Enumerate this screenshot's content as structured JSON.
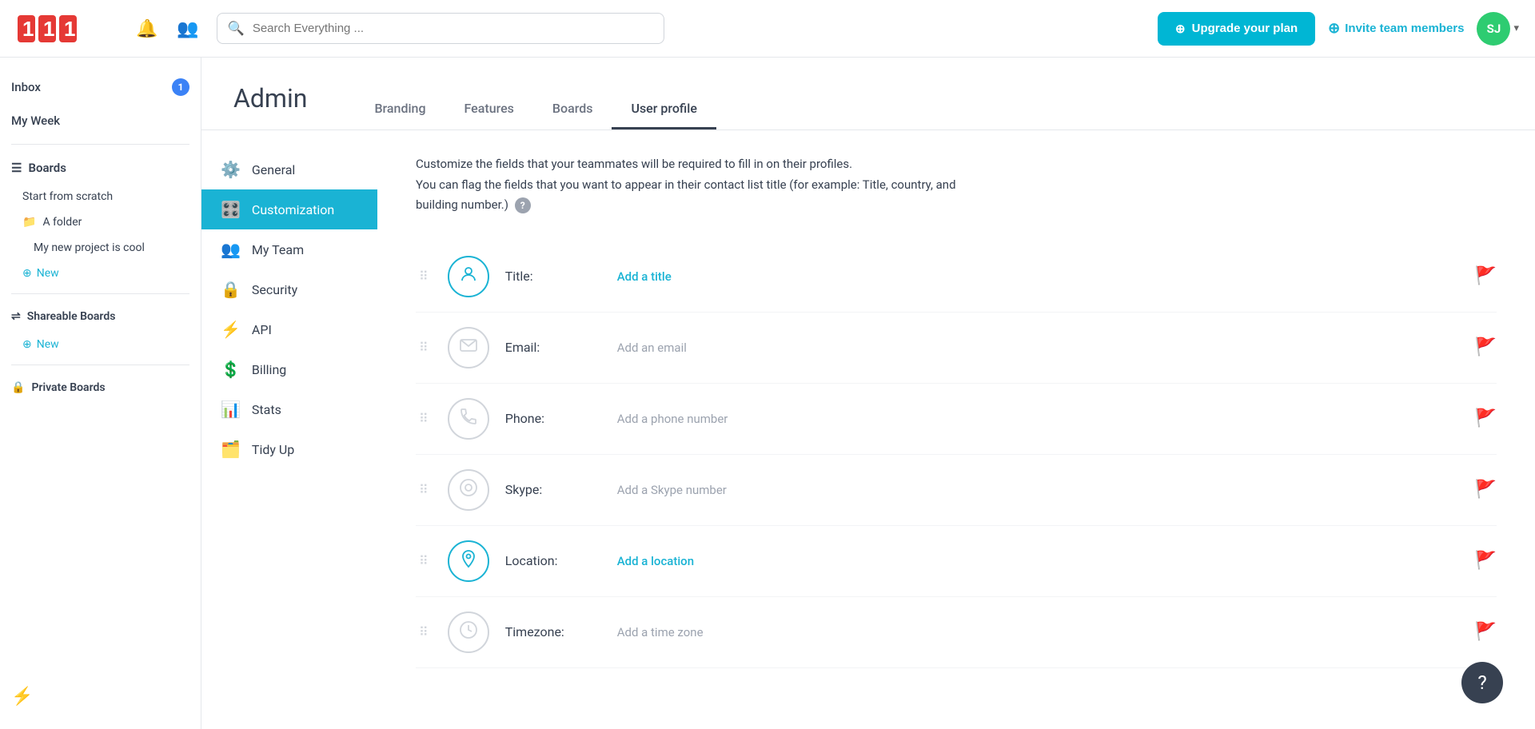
{
  "header": {
    "search_placeholder": "Search Everything ...",
    "upgrade_label": "Upgrade your plan",
    "invite_label": "Invite team members",
    "avatar_initials": "SJ"
  },
  "sidebar": {
    "inbox_label": "Inbox",
    "inbox_badge": "1",
    "my_week_label": "My Week",
    "boards_label": "Boards",
    "start_scratch_label": "Start from scratch",
    "folder_label": "A folder",
    "project_label": "My new project is cool",
    "new_label": "New",
    "shareable_label": "Shareable Boards",
    "new2_label": "New",
    "private_label": "Private Boards"
  },
  "admin": {
    "title": "Admin",
    "tabs": [
      {
        "id": "branding",
        "label": "Branding"
      },
      {
        "id": "features",
        "label": "Features"
      },
      {
        "id": "boards",
        "label": "Boards"
      },
      {
        "id": "user-profile",
        "label": "User profile"
      }
    ],
    "active_tab": "user-profile",
    "menu": [
      {
        "id": "general",
        "label": "General",
        "icon": "⚙️"
      },
      {
        "id": "customization",
        "label": "Customization",
        "icon": "🎛️",
        "active": true
      },
      {
        "id": "my-team",
        "label": "My Team",
        "icon": "👥"
      },
      {
        "id": "security",
        "label": "Security",
        "icon": "🔒"
      },
      {
        "id": "api",
        "label": "API",
        "icon": "⚡"
      },
      {
        "id": "billing",
        "label": "Billing",
        "icon": "💲"
      },
      {
        "id": "stats",
        "label": "Stats",
        "icon": "📊"
      },
      {
        "id": "tidy-up",
        "label": "Tidy Up",
        "icon": "🗂️"
      }
    ],
    "profile": {
      "description_1": "Customize the fields that your teammates will be required to fill in on their profiles.",
      "description_2": "You can flag the fields that you want to appear in their contact list title (for example: Title, country, and building number.)",
      "fields": [
        {
          "id": "title",
          "label": "Title:",
          "placeholder": "Add a title",
          "placeholder_type": "link",
          "icon": "👤",
          "icon_type": "teal"
        },
        {
          "id": "email",
          "label": "Email:",
          "placeholder": "Add an email",
          "placeholder_type": "text",
          "icon": "✉️",
          "icon_type": "normal"
        },
        {
          "id": "phone",
          "label": "Phone:",
          "placeholder": "Add a phone number",
          "placeholder_type": "text",
          "icon": "📞",
          "icon_type": "normal"
        },
        {
          "id": "skype",
          "label": "Skype:",
          "placeholder": "Add a Skype number",
          "placeholder_type": "text",
          "icon": "💬",
          "icon_type": "normal"
        },
        {
          "id": "location",
          "label": "Location:",
          "placeholder": "Add a location",
          "placeholder_type": "link",
          "icon": "📍",
          "icon_type": "teal"
        },
        {
          "id": "timezone",
          "label": "Timezone:",
          "placeholder": "Add a time zone",
          "placeholder_type": "text",
          "icon": "🕐",
          "icon_type": "normal"
        }
      ]
    }
  },
  "help_label": "?"
}
